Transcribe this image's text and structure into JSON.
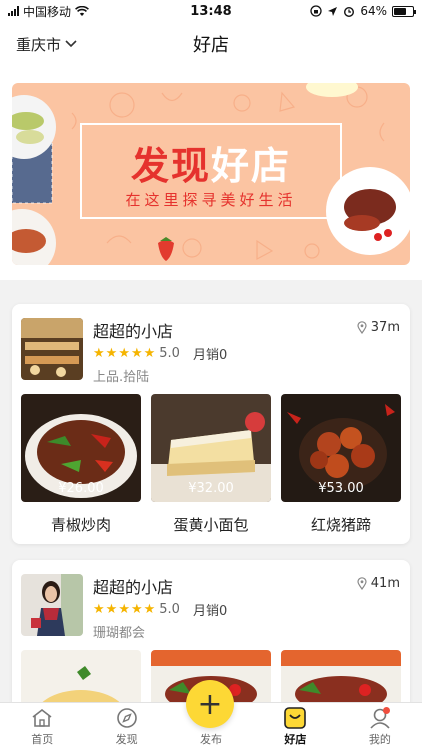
{
  "status": {
    "carrier": "中国移动",
    "time": "13:48",
    "battery": "64%",
    "battery_level": 0.64
  },
  "nav": {
    "city": "重庆市",
    "title": "好店"
  },
  "banner": {
    "title_red": "发现",
    "title_white": "好店",
    "subtitle": "在这里探寻美好生活"
  },
  "shops": [
    {
      "name": "超超的小店",
      "rating": "5.0",
      "sales": "月销0",
      "area": "上品.拾陆",
      "distance": "37m",
      "dishes": [
        {
          "name": "青椒炒肉",
          "price": "¥26.00"
        },
        {
          "name": "蛋黄小面包",
          "price": "¥32.00"
        },
        {
          "name": "红烧猪蹄",
          "price": "¥53.00"
        }
      ]
    },
    {
      "name": "超超的小店",
      "rating": "5.0",
      "sales": "月销0",
      "area": "珊瑚都会",
      "distance": "41m"
    }
  ],
  "tabs": [
    {
      "label": "首页",
      "icon": "home-icon"
    },
    {
      "label": "发现",
      "icon": "compass-icon"
    },
    {
      "label": "发布",
      "icon": "plus-icon"
    },
    {
      "label": "好店",
      "icon": "shop-icon"
    },
    {
      "label": "我的",
      "icon": "user-icon"
    }
  ],
  "colors": {
    "accent": "#fdd835",
    "star": "#f5b400",
    "banner_red": "#e5322d",
    "banner_bg": "#fbc4a2"
  }
}
